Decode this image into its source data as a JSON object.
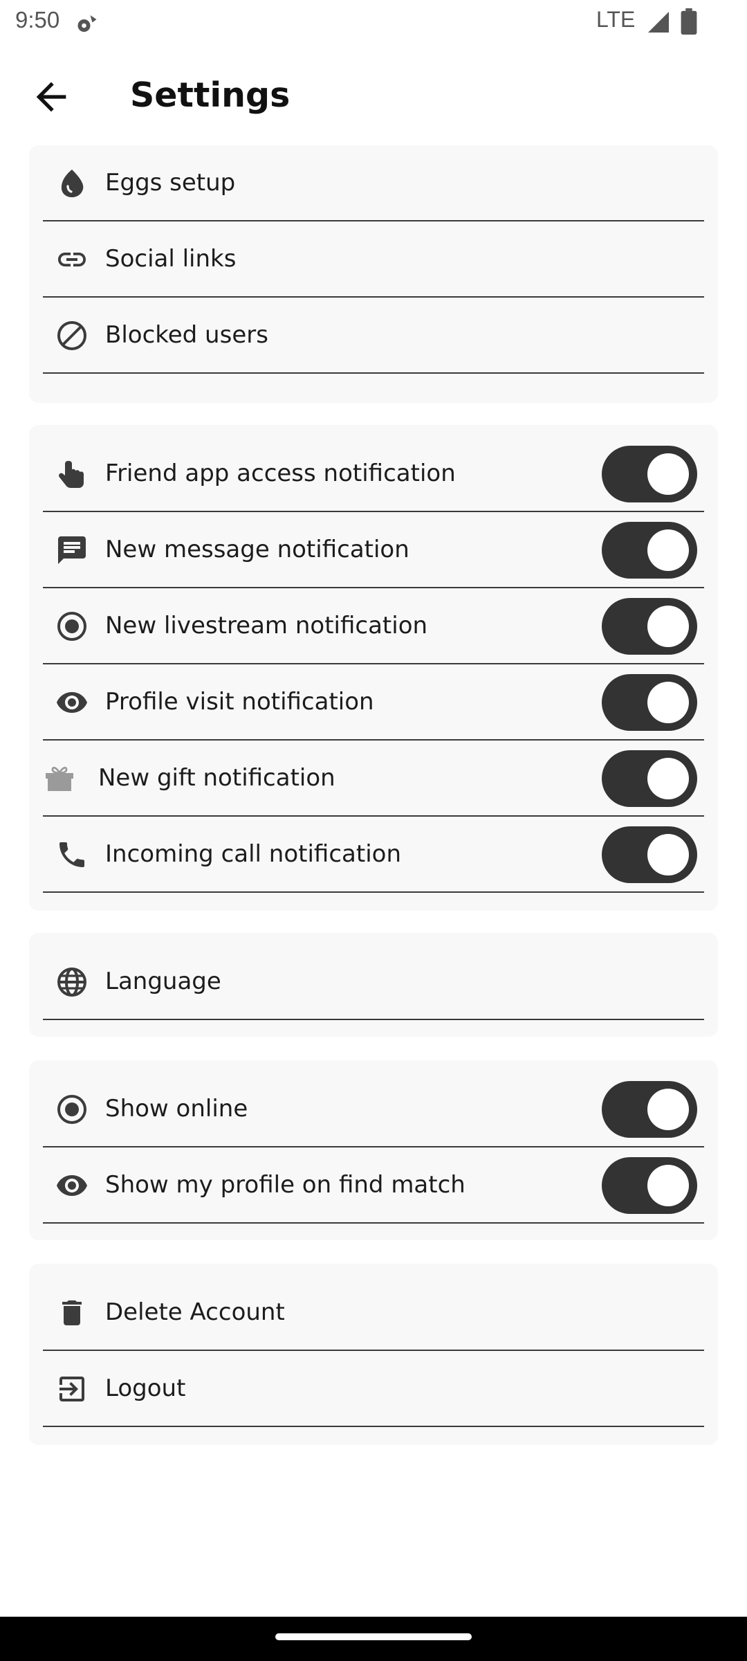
{
  "status_bar": {
    "time": "9:50",
    "network": "LTE"
  },
  "header": {
    "title": "Settings"
  },
  "sections": {
    "account": {
      "eggs_setup": "Eggs setup",
      "social_links": "Social links",
      "blocked_users": "Blocked users"
    },
    "notifications": {
      "friend_app_access": {
        "label": "Friend app access notification",
        "enabled": true
      },
      "new_message": {
        "label": "New message notification",
        "enabled": true
      },
      "new_livestream": {
        "label": "New livestream notification",
        "enabled": true
      },
      "profile_visit": {
        "label": "Profile visit notification",
        "enabled": true
      },
      "new_gift": {
        "label": "New gift notification",
        "enabled": true
      },
      "incoming_call": {
        "label": "Incoming call notification",
        "enabled": true
      }
    },
    "preferences": {
      "language": "Language"
    },
    "privacy": {
      "show_online": {
        "label": "Show online",
        "enabled": true
      },
      "show_profile_find_match": {
        "label": "Show my profile on find match",
        "enabled": true
      }
    },
    "danger": {
      "delete_account": "Delete Account",
      "logout": "Logout"
    }
  },
  "icons": {
    "eggs_setup": "egg-icon",
    "social_links": "link-icon",
    "blocked_users": "block-icon",
    "friend_app_access": "touch-hand-icon",
    "new_message": "message-icon",
    "new_livestream": "radio-button-icon",
    "profile_visit": "eye-icon",
    "new_gift": "gift-icon",
    "incoming_call": "phone-icon",
    "language": "globe-icon",
    "show_online": "radio-button-icon",
    "show_profile_find_match": "eye-icon",
    "delete_account": "trash-icon",
    "logout": "logout-icon"
  },
  "colors": {
    "toggle_on": "#333333",
    "card_background": "#f8f8f8",
    "icon": "#3c3c3c"
  }
}
